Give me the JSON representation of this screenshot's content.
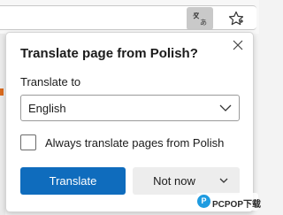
{
  "toolbar": {
    "translate_icon": "translate-icon",
    "favorite_icon": "star-icon"
  },
  "popup": {
    "title": "Translate page from Polish?",
    "close_icon": "close-icon",
    "translate_to_label": "Translate to",
    "language_select": {
      "selected": "English",
      "chevron_icon": "chevron-down-icon"
    },
    "always_translate": {
      "checked": false,
      "label": "Always translate pages from Polish"
    },
    "translate_button": "Translate",
    "not_now_button": "Not now",
    "not_now_chevron_icon": "chevron-down-icon"
  },
  "watermark": {
    "text": "PCPOP下载",
    "circle_glyph": "P"
  },
  "colors": {
    "accent": "#0f6cbd",
    "page_accent": "#d86a1e"
  }
}
